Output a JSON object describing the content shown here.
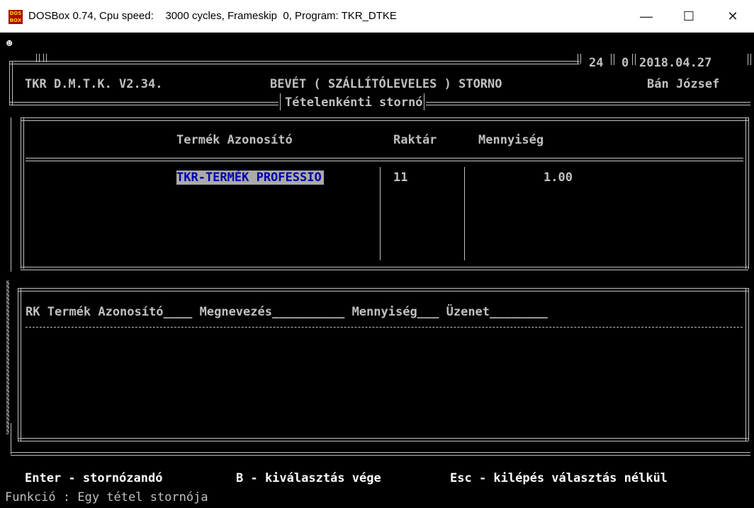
{
  "window": {
    "title": "DOSBox 0.74, Cpu speed:    3000 cycles, Frameskip  0, Program: TKR_DTKE",
    "icon_text": "DOS BOX",
    "minimize_glyph": "—",
    "maximize_glyph": "☐",
    "close_glyph": "✕"
  },
  "header": {
    "corner_glyph": "☻",
    "app_name": "TKR D.M.T.K. V2.34.",
    "module_title": "BEVÉT ( SZÁLLÍTÓLEVELES ) STORNO",
    "counter_a": "24",
    "counter_b": "0",
    "date": "2018.04.27",
    "user": "Bán József",
    "subtitle": "Tételenkénti stornó"
  },
  "upper_table": {
    "columns": [
      "Termék Azonosító",
      "Raktár",
      "Mennyiség"
    ],
    "rows": [
      {
        "product": "TKR-TERMÉK PROFESSIO",
        "warehouse": "11",
        "quantity": "1.00"
      }
    ]
  },
  "lower_table": {
    "header": "RK Termék Azonosító____ Megnevezés__________ Mennyiség___ Üzenet________"
  },
  "footer": {
    "hint_enter": "Enter - stornózandó",
    "hint_b": "B - kiválasztás vége",
    "hint_esc": "Esc - kilépés választás nélkül",
    "function_line": "Funkció : Egy tétel stornója"
  },
  "colors": {
    "screen_bg": "#000000",
    "text": "#c0c0c0",
    "highlight_bg": "#aaaaaa",
    "highlight_fg": "#0000aa",
    "titlebar_bg": "#ffffff"
  }
}
